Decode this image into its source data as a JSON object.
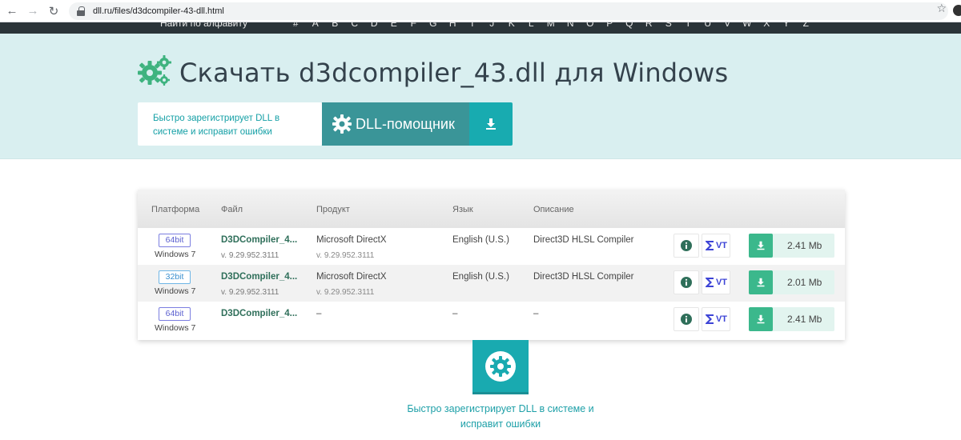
{
  "browser": {
    "url": "dll.ru/files/d3dcompiler-43-dll.html"
  },
  "alphabet": {
    "label": "Найти по алфавиту",
    "letters": [
      "#",
      "A",
      "B",
      "C",
      "D",
      "E",
      "F",
      "G",
      "H",
      "I",
      "J",
      "K",
      "L",
      "M",
      "N",
      "O",
      "P",
      "Q",
      "R",
      "S",
      "T",
      "U",
      "V",
      "W",
      "X",
      "Y",
      "Z"
    ]
  },
  "header": {
    "title": "Скачать d3dcompiler_43.dll для Windows",
    "promo_text": "Быстро зарегистрирует DLL в системе и исправит ошибки",
    "helper_label": "DLL-помощник"
  },
  "table": {
    "columns": {
      "platform": "Платформа",
      "file": "Файл",
      "product": "Продукт",
      "language": "Язык",
      "description": "Описание"
    },
    "rows": [
      {
        "bit": "64bit",
        "os": "Windows 7",
        "file": "D3DCompiler_4...",
        "file_version": "v. 9.29.952.3111",
        "product": "Microsoft DirectX",
        "product_version": "v. 9.29.952.3111",
        "language": "English (U.S.)",
        "description": "Direct3D HLSL Compiler",
        "size": "2.41 Mb"
      },
      {
        "bit": "32bit",
        "os": "Windows 7",
        "file": "D3DCompiler_4...",
        "file_version": "v. 9.29.952.3111",
        "product": "Microsoft DirectX",
        "product_version": "v. 9.29.952.3111",
        "language": "English (U.S.)",
        "description": "Direct3D HLSL Compiler",
        "size": "2.01 Mb"
      },
      {
        "bit": "64bit",
        "os": "Windows 7",
        "file": "D3DCompiler_4...",
        "file_version": "",
        "product": "–",
        "product_version": "",
        "language": "–",
        "description": "–",
        "size": "2.41 Mb"
      }
    ],
    "vt_label": "VT"
  },
  "bottom_promo": {
    "text": "Быстро зарегистрирует DLL в системе и исправит ошибки"
  },
  "colors": {
    "accent": "#18abb0",
    "helper_bg": "#3a9598",
    "hero_bg": "#d9eff0",
    "download_green": "#3bb88c"
  }
}
